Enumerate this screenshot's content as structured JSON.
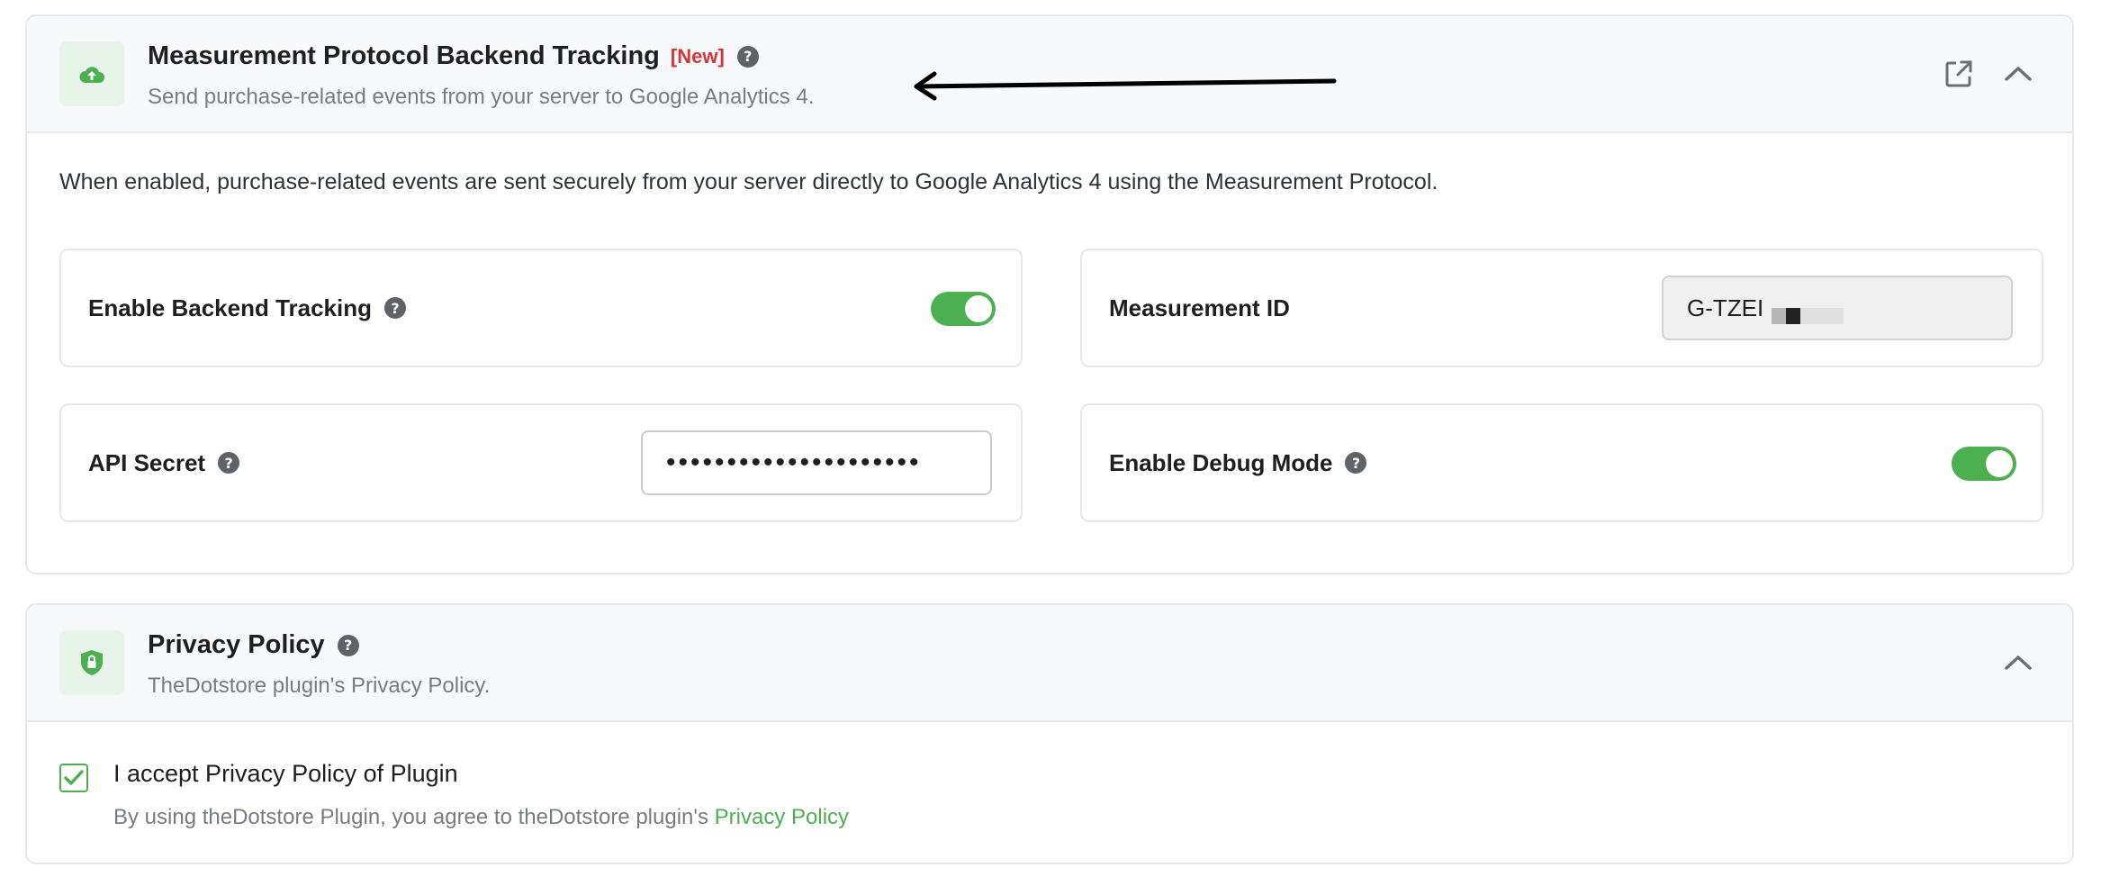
{
  "measurement_protocol": {
    "title": "Measurement Protocol Backend Tracking",
    "badge": "[New]",
    "subtitle": "Send purchase-related events from your server to Google Analytics 4.",
    "description": "When enabled, purchase-related events are sent securely from your server directly to Google Analytics 4 using the Measurement Protocol.",
    "fields": {
      "enable_backend": {
        "label": "Enable Backend Tracking",
        "enabled": true
      },
      "measurement_id": {
        "label": "Measurement ID",
        "value": "G-TZEI"
      },
      "api_secret": {
        "label": "API Secret",
        "value": "•••••••••••••••••••••"
      },
      "debug_mode": {
        "label": "Enable Debug Mode",
        "enabled": true
      }
    }
  },
  "privacy_policy": {
    "title": "Privacy Policy",
    "subtitle": "TheDotstore plugin's Privacy Policy.",
    "accept_label": "I accept Privacy Policy of Plugin",
    "accepted": true,
    "note_prefix": "By using theDotstore Plugin, you agree to theDotstore plugin's",
    "link_text": "Privacy Policy"
  },
  "icons": {
    "card1": "cloud-upload-icon",
    "card2": "shield-lock-icon",
    "help": "question-circle-icon",
    "external": "external-link-icon",
    "collapse": "chevron-up-icon",
    "annotation": "arrow-left-icon"
  },
  "colors": {
    "accent": "#4caf50",
    "badge": "#d63638",
    "header_bg": "#f8f9fb",
    "icon_bg": "#e8f4ea",
    "border": "#e6e8eb"
  }
}
